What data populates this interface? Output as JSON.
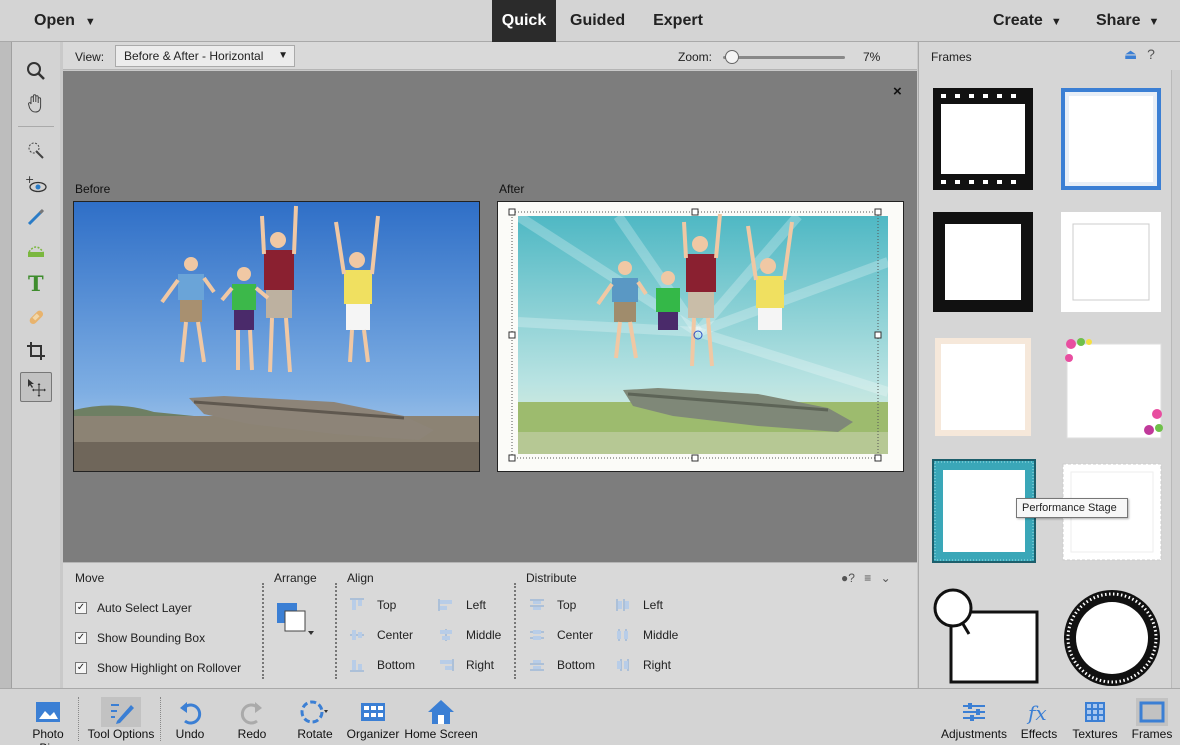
{
  "top": {
    "open_label": "Open",
    "modes": [
      "Quick",
      "Guided",
      "Expert"
    ],
    "active_mode": "Quick",
    "create_label": "Create",
    "share_label": "Share"
  },
  "left_tools": [
    "zoom-icon",
    "hand-icon",
    "quick-selection-icon",
    "red-eye-icon",
    "whiten-teeth-icon",
    "straighten-icon",
    "type-icon",
    "spot-healing-icon",
    "crop-icon",
    "move-icon"
  ],
  "viewbar": {
    "view_label": "View:",
    "view_value": "Before & After - Horizontal",
    "zoom_label": "Zoom:",
    "zoom_value": "7%",
    "zoom_fraction": 0.07
  },
  "canvas": {
    "before_label": "Before",
    "after_label": "After",
    "close_label": "×"
  },
  "tool_options": {
    "move_title": "Move",
    "checkboxes": [
      {
        "label": "Auto Select Layer",
        "checked": true
      },
      {
        "label": "Show Bounding Box",
        "checked": true
      },
      {
        "label": "Show Highlight on Rollover",
        "checked": true
      }
    ],
    "arrange_title": "Arrange",
    "align_title": "Align",
    "align_items": [
      "Top",
      "Center",
      "Bottom",
      "Left",
      "Middle",
      "Right"
    ],
    "distribute_title": "Distribute",
    "distribute_items": [
      "Top",
      "Center",
      "Bottom",
      "Left",
      "Middle",
      "Right"
    ]
  },
  "panel": {
    "title": "Frames",
    "tooltip": "Performance Stage"
  },
  "bottom": {
    "left_buttons": [
      "Photo Bin",
      "Tool Options",
      "Undo",
      "Redo",
      "Rotate",
      "Organizer",
      "Home Screen"
    ],
    "right_buttons": [
      "Adjustments",
      "Effects",
      "Textures",
      "Frames"
    ]
  },
  "colors": {
    "accent_blue": "#3b7fd4",
    "active_tab_bg": "#2b2b2b",
    "frame_teal": "#3aa7b8"
  }
}
